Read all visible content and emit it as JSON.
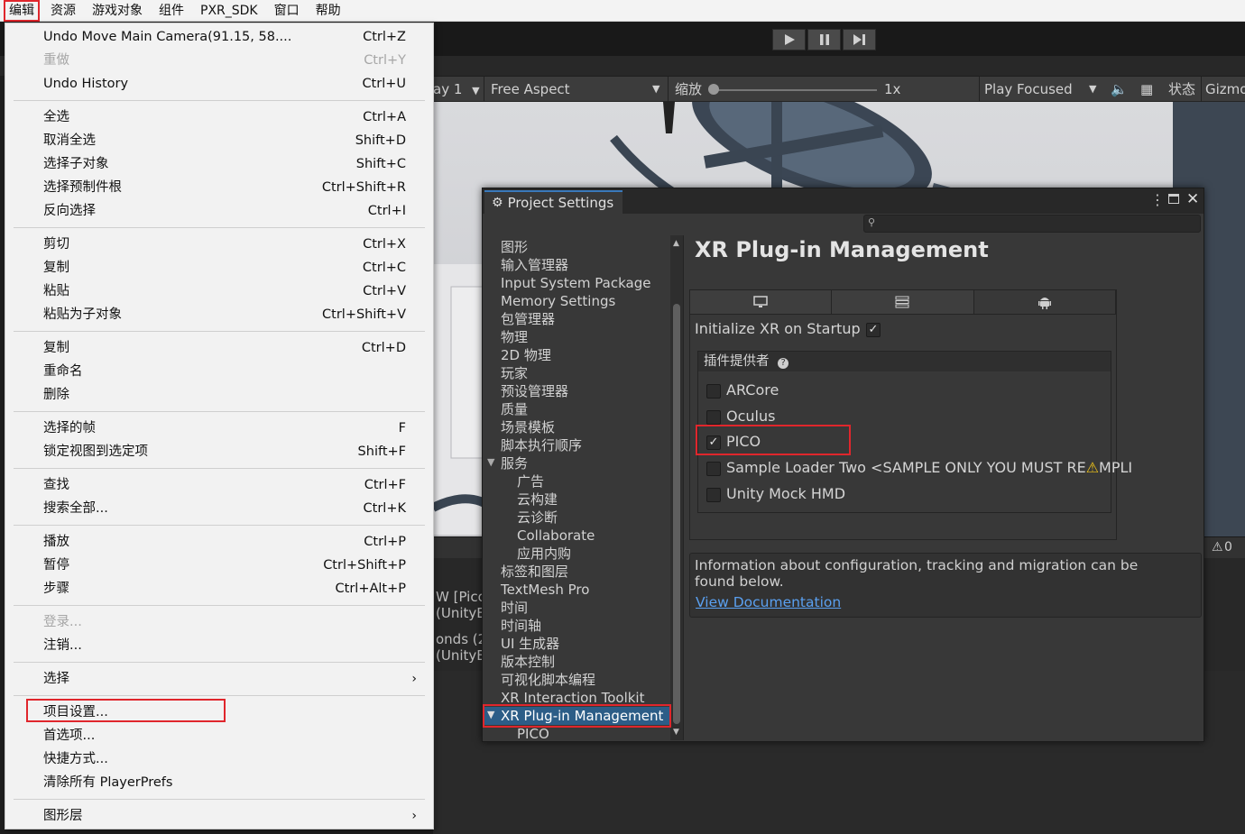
{
  "menubar": [
    "编辑",
    "资源",
    "游戏对象",
    "组件",
    "PXR_SDK",
    "窗口",
    "帮助"
  ],
  "gameview": {
    "display_partial": "ay 1",
    "aspect": "Free Aspect",
    "scale_label": "缩放",
    "scale_value": "1x",
    "play_mode": "Play Focused",
    "stats": "状态",
    "gizmos": "Gizmo",
    "warn_count": "0"
  },
  "console": [
    "W [Pico",
    "(UnityE",
    "onds (2",
    "(UnityE"
  ],
  "edit_menu": {
    "rows": [
      {
        "label": "Undo Move Main Camera(91.15, 58....",
        "shortcut": "Ctrl+Z"
      },
      {
        "label": "重做",
        "shortcut": "Ctrl+Y"
      },
      {
        "label": "Undo History",
        "shortcut": "Ctrl+U"
      },
      {
        "label": "全选",
        "shortcut": "Ctrl+A"
      },
      {
        "label": "取消全选",
        "shortcut": "Shift+D"
      },
      {
        "label": "选择子对象",
        "shortcut": "Shift+C"
      },
      {
        "label": "选择预制件根",
        "shortcut": "Ctrl+Shift+R"
      },
      {
        "label": "反向选择",
        "shortcut": "Ctrl+I"
      },
      {
        "label": "剪切",
        "shortcut": "Ctrl+X"
      },
      {
        "label": "复制",
        "shortcut": "Ctrl+C"
      },
      {
        "label": "粘贴",
        "shortcut": "Ctrl+V"
      },
      {
        "label": "粘贴为子对象",
        "shortcut": "Ctrl+Shift+V"
      },
      {
        "label": "复制",
        "shortcut": "Ctrl+D"
      },
      {
        "label": "重命名",
        "shortcut": ""
      },
      {
        "label": "删除",
        "shortcut": ""
      },
      {
        "label": "选择的帧",
        "shortcut": "F"
      },
      {
        "label": "锁定视图到选定项",
        "shortcut": "Shift+F"
      },
      {
        "label": "查找",
        "shortcut": "Ctrl+F"
      },
      {
        "label": "搜索全部...",
        "shortcut": "Ctrl+K"
      },
      {
        "label": "播放",
        "shortcut": "Ctrl+P"
      },
      {
        "label": "暂停",
        "shortcut": "Ctrl+Shift+P"
      },
      {
        "label": "步骤",
        "shortcut": "Ctrl+Alt+P"
      },
      {
        "label": "登录...",
        "shortcut": ""
      },
      {
        "label": "注销...",
        "shortcut": ""
      },
      {
        "label": "选择",
        "shortcut": ""
      },
      {
        "label": "项目设置...",
        "shortcut": ""
      },
      {
        "label": "首选项...",
        "shortcut": ""
      },
      {
        "label": "快捷方式...",
        "shortcut": ""
      },
      {
        "label": "清除所有 PlayerPrefs",
        "shortcut": ""
      },
      {
        "label": "图形层",
        "shortcut": ""
      }
    ]
  },
  "project_settings": {
    "title": "Project Settings",
    "nav": [
      "图形",
      "输入管理器",
      "Input System Package",
      "Memory Settings",
      "包管理器",
      "物理",
      "2D 物理",
      "玩家",
      "预设管理器",
      "质量",
      "场景模板",
      "脚本执行顺序",
      "服务",
      "广告",
      "云构建",
      "云诊断",
      "Collaborate",
      "应用内购",
      "标签和图层",
      "TextMesh Pro",
      "时间",
      "时间轴",
      "UI 生成器",
      "版本控制",
      "可视化脚本编程",
      "XR Interaction Toolkit",
      "XR Plug-in Management",
      "PICO"
    ],
    "heading": "XR Plug-in Management",
    "init_label": "Initialize XR on Startup",
    "providers_label": "插件提供者",
    "providers": [
      {
        "name": "ARCore",
        "checked": false
      },
      {
        "name": "Oculus",
        "checked": false
      },
      {
        "name": "PICO",
        "checked": true
      },
      {
        "name": "Sample Loader Two <SAMPLE ONLY YOU MUST RE",
        "suffix": "MPLI",
        "checked": false
      },
      {
        "name": "Unity Mock HMD",
        "checked": false
      }
    ],
    "info_text": "Information about configuration, tracking and migration can be found below.",
    "info_link": "View Documentation"
  },
  "colors": {
    "highlight": "#e0262c",
    "selection": "#2c5d87",
    "link": "#5aa0f0"
  }
}
